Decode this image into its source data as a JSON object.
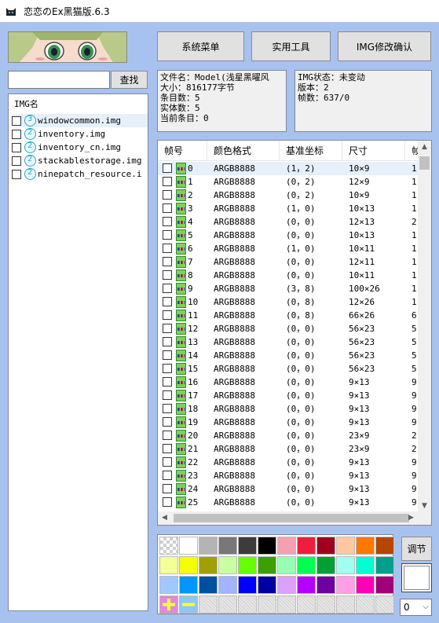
{
  "window": {
    "title": "恋恋のEx黑猫版.6.3"
  },
  "toolbar": {
    "system_menu": "系统菜单",
    "tools": "实用工具",
    "img_confirm": "IMG修改确认",
    "search": "查找"
  },
  "search": {
    "value": "",
    "placeholder": ""
  },
  "img_list": {
    "header": "IMG名",
    "items": [
      {
        "name": "windowcommon.img",
        "selected": true
      },
      {
        "name": "inventory.img"
      },
      {
        "name": "inventory_cn.img"
      },
      {
        "name": "stackablestorage.img"
      },
      {
        "name": "ninepatch_resource.i"
      }
    ]
  },
  "file_info": {
    "line1": "文件名：Model(浅星黑曜风",
    "line2": "大小：816177字节",
    "line3": "条目数：5",
    "line4": "实体数：5",
    "line5": "当前条目：0"
  },
  "img_status": {
    "line1": "IMG状态：未变动",
    "line2": "版本：2",
    "line3": "帧数：637/0"
  },
  "frames_table": {
    "columns": [
      "帧号",
      "颜色格式",
      "基准坐标",
      "尺寸",
      "帧"
    ],
    "rows": [
      [
        "0",
        "ARGB8888",
        "(1，2)",
        "10×9",
        "1"
      ],
      [
        "1",
        "ARGB8888",
        "(0，2)",
        "12×9",
        "1:"
      ],
      [
        "2",
        "ARGB8888",
        "(0，2)",
        "10×9",
        "1"
      ],
      [
        "3",
        "ARGB8888",
        "(1，0)",
        "10×13",
        "1"
      ],
      [
        "4",
        "ARGB8888",
        "(0，0)",
        "12×13",
        "2"
      ],
      [
        "5",
        "ARGB8888",
        "(0，0)",
        "10×13",
        "1"
      ],
      [
        "6",
        "ARGB8888",
        "(1，0)",
        "10×11",
        "1"
      ],
      [
        "7",
        "ARGB8888",
        "(0，0)",
        "12×11",
        "1:"
      ],
      [
        "8",
        "ARGB8888",
        "(0，0)",
        "10×11",
        "1"
      ],
      [
        "9",
        "ARGB8888",
        "(3，8)",
        "100×26",
        "1"
      ],
      [
        "10",
        "ARGB8888",
        "(0，8)",
        "12×26",
        "1:"
      ],
      [
        "11",
        "ARGB8888",
        "(0，8)",
        "66×26",
        "6"
      ],
      [
        "12",
        "ARGB8888",
        "(0，0)",
        "56×23",
        "5"
      ],
      [
        "13",
        "ARGB8888",
        "(0，0)",
        "56×23",
        "5"
      ],
      [
        "14",
        "ARGB8888",
        "(0，0)",
        "56×23",
        "5"
      ],
      [
        "15",
        "ARGB8888",
        "(0，0)",
        "56×23",
        "5"
      ],
      [
        "16",
        "ARGB8888",
        "(0，0)",
        "9×13",
        "9"
      ],
      [
        "17",
        "ARGB8888",
        "(0，0)",
        "9×13",
        "9"
      ],
      [
        "18",
        "ARGB8888",
        "(0，0)",
        "9×13",
        "9"
      ],
      [
        "19",
        "ARGB8888",
        "(0，0)",
        "9×13",
        "9"
      ],
      [
        "20",
        "ARGB8888",
        "(0，0)",
        "23×9",
        "2"
      ],
      [
        "21",
        "ARGB8888",
        "(0，0)",
        "23×9",
        "2"
      ],
      [
        "22",
        "ARGB8888",
        "(0，0)",
        "9×13",
        "9"
      ],
      [
        "23",
        "ARGB8888",
        "(0，0)",
        "9×13",
        "9"
      ],
      [
        "24",
        "ARGB8888",
        "(0，0)",
        "9×13",
        "9"
      ],
      [
        "25",
        "ARGB8888",
        "(0，0)",
        "9×13",
        "9"
      ]
    ]
  },
  "palette": {
    "colors": [
      [
        "checker",
        "#ffffff",
        "#b4b4b4",
        "#787878",
        "#3c3c3c",
        "#000000",
        "#f4a0b0",
        "#f01e3c",
        "#a0001e",
        "#ffc8a0",
        "#ff7800",
        "#b44600"
      ],
      [
        "#f4ff96",
        "#f4ff00",
        "#a0a000",
        "#c8ffa0",
        "#64ff00",
        "#3ca000",
        "#96ffb4",
        "#00ff50",
        "#00a032",
        "#a0fff0",
        "#00ffd2",
        "#00a08c"
      ],
      [
        "#a0c8ff",
        "#0096ff",
        "#0050a0",
        "#a0b4ff",
        "#0000ff",
        "#0000a0",
        "#dca0ff",
        "#b400ff",
        "#6e00a0",
        "#ffa0e6",
        "#ff00b4",
        "#a00078"
      ],
      [
        "add",
        "remove",
        "hatch",
        "hatch",
        "hatch",
        "hatch",
        "hatch",
        "hatch",
        "hatch",
        "hatch",
        "hatch",
        "hatch"
      ]
    ],
    "adjust_button": "调节",
    "selected_color": "#ffffff",
    "index_select": "0"
  }
}
